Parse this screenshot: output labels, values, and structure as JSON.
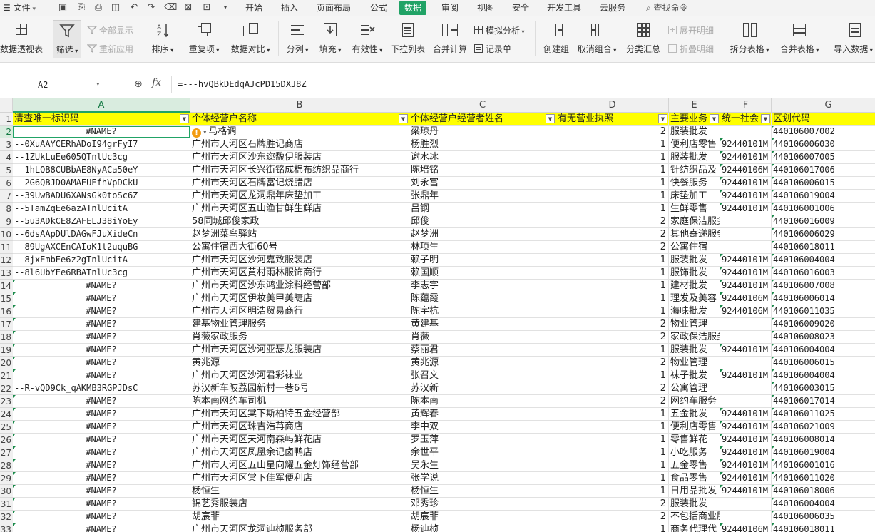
{
  "menubar": {
    "file_label": "文件",
    "tabs": [
      "开始",
      "插入",
      "页面布局",
      "公式",
      "数据",
      "审阅",
      "视图",
      "安全",
      "开发工具",
      "云服务"
    ],
    "active_tab": "数据",
    "search_label": "查找命令"
  },
  "ribbon": {
    "pivot": "数据透视表",
    "filter": "筛选",
    "show_all": "全部显示",
    "reapply": "重新应用",
    "sort": "排序",
    "duplicates": "重复项",
    "compare": "数据对比",
    "split": "分列",
    "fill": "填充",
    "validity": "有效性",
    "dropdown_list": "下拉列表",
    "merge_calc": "合并计算",
    "simulate": "模拟分析",
    "record": "记录单",
    "create_group": "创建组",
    "ungroup": "取消组合",
    "subtotal": "分类汇总",
    "expand_detail": "展开明细",
    "collapse_detail": "折叠明细",
    "split_table": "拆分表格",
    "merge_table": "合并表格",
    "import": "导入数据"
  },
  "formula_bar": {
    "cell_ref": "A2",
    "formula": "=---hvQBkDEdqAJcPD15DXJ8Z"
  },
  "columns": [
    "A",
    "B",
    "C",
    "D",
    "E",
    "F",
    "G"
  ],
  "active_column": "A",
  "header_row": [
    "清查唯一标识码",
    "个体经营户名称",
    "个体经营户经营者姓名",
    "有无营业执照",
    "主要业务",
    "统一社会",
    "区划代码"
  ],
  "rows": [
    {
      "n": "2",
      "a": "#NAME?",
      "b": "马格调",
      "c": "梁琼丹",
      "d": "2",
      "e": "服装批发",
      "f": "",
      "g": "440106007002"
    },
    {
      "n": "3",
      "a": "--0XuAAYCERhADoI94grFyI7",
      "b": "广州市天河区石牌胜记商店",
      "c": "杨胜烈",
      "d": "1",
      "e": "便利店零售",
      "f": "92440101M",
      "g": "440106006030"
    },
    {
      "n": "4",
      "a": "--1ZUkLuEe605QTnlUc3cg",
      "b": "广州市天河区沙东迩馥伊服装店",
      "c": "谢水冰",
      "d": "1",
      "e": "服装批发",
      "f": "92440101M",
      "g": "440106007005"
    },
    {
      "n": "5",
      "a": "--1hLQB8CUBbAE8NyACa50eY",
      "b": "广州市天河区长兴街铭成棉布纺织品商行",
      "c": "陈培铭",
      "d": "1",
      "e": "针纺织品及",
      "f": "92440106M",
      "g": "440106017006"
    },
    {
      "n": "6",
      "a": "--2G6QBJD0AMAEUEfhVpDCkU",
      "b": "广州市天河区石牌富记烧腊店",
      "c": "刘永富",
      "d": "1",
      "e": "快餐服务",
      "f": "92440101M",
      "g": "440106006015"
    },
    {
      "n": "7",
      "a": "--39UwBADU6XANsGk0toSc6Z",
      "b": "广州市天河区龙洞鼎年床垫加工",
      "c": "张鼎年",
      "d": "1",
      "e": "床垫加工",
      "f": "92440101M",
      "g": "440106019004"
    },
    {
      "n": "8",
      "a": "--5TamZqEe6azATnlUcitA",
      "b": "广州市天河区五山渔甘鲜生鲜店",
      "c": "吕钢",
      "d": "1",
      "e": "生鲜零售",
      "f": "92440101M",
      "g": "440106001006"
    },
    {
      "n": "9",
      "a": "--5u3ADkCE8ZAFELJ38iYoEy",
      "b": "58同城邱俊家政",
      "c": "邱俊",
      "d": "2",
      "e": "家庭保洁服务",
      "f": "",
      "g": "440106016009"
    },
    {
      "n": "10",
      "a": "--6dsAApDUlDAGwFJuXideCn",
      "b": "赵梦洲菜鸟驿站",
      "c": "赵梦洲",
      "d": "2",
      "e": "其他寄递服务",
      "f": "",
      "g": "440106006029"
    },
    {
      "n": "11",
      "a": "--89UgAXCEnCAIoK1t2uquBG",
      "b": "公寓住宿西大街60号",
      "c": "林项生",
      "d": "2",
      "e": "公寓住宿",
      "f": "",
      "g": "440106018011"
    },
    {
      "n": "12",
      "a": "--8jxEmbEe6z2gTnlUcitA",
      "b": "广州市天河区沙河嘉致服装店",
      "c": "赖子明",
      "d": "1",
      "e": "服装批发",
      "f": "92440101M",
      "g": "440106004004"
    },
    {
      "n": "13",
      "a": "--8l6UbYEe6RBATnlUc3cg",
      "b": "广州市天河区黄村雨林服饰商行",
      "c": "赖国顺",
      "d": "1",
      "e": "服饰批发",
      "f": "92440101M",
      "g": "440106016003"
    },
    {
      "n": "14",
      "a": "#NAME?",
      "b": "广州市天河区沙东鸿业涂料经营部",
      "c": "李志宇",
      "d": "1",
      "e": "建材批发",
      "f": "92440101M",
      "g": "440106007008"
    },
    {
      "n": "15",
      "a": "#NAME?",
      "b": "广州市天河区伊妆美甲美睫店",
      "c": "陈蕴霞",
      "d": "1",
      "e": "理发及美容",
      "f": "92440106M",
      "g": "440106006014"
    },
    {
      "n": "16",
      "a": "#NAME?",
      "b": "广州市天河区明浩贸易商行",
      "c": "陈宇杭",
      "d": "1",
      "e": "海味批发",
      "f": "92440106M",
      "g": "440106011035"
    },
    {
      "n": "17",
      "a": "#NAME?",
      "b": "建基物业管理服务",
      "c": "黄建基",
      "d": "2",
      "e": "物业管理",
      "f": "",
      "g": "440106009020"
    },
    {
      "n": "18",
      "a": "#NAME?",
      "b": "肖薇家政服务",
      "c": "肖薇",
      "d": "2",
      "e": "家政保洁服务",
      "f": "",
      "g": "440106008023"
    },
    {
      "n": "19",
      "a": "#NAME?",
      "b": "广州市天河区沙河亚瑟龙服装店",
      "c": "蔡丽君",
      "d": "1",
      "e": "服装批发",
      "f": "92440101M",
      "g": "440106004004"
    },
    {
      "n": "20",
      "a": "#NAME?",
      "b": "黄兆源",
      "c": "黄兆源",
      "d": "2",
      "e": "物业管理",
      "f": "",
      "g": "440106006015"
    },
    {
      "n": "21",
      "a": "#NAME?",
      "b": "广州市天河区沙河君彩袜业",
      "c": "张召文",
      "d": "1",
      "e": "袜子批发",
      "f": "92440101M",
      "g": "440106004004"
    },
    {
      "n": "22",
      "a": "--R-vQD9Ck_qAKMB3RGPJDsC",
      "b": "苏汉新车陂荔园新村一巷6号",
      "c": "苏汉新",
      "d": "2",
      "e": "公寓管理",
      "f": "",
      "g": "440106003015"
    },
    {
      "n": "23",
      "a": "#NAME?",
      "b": "陈本南网约车司机",
      "c": "陈本南",
      "d": "2",
      "e": "网约车服务",
      "f": "",
      "g": "440106017014"
    },
    {
      "n": "24",
      "a": "#NAME?",
      "b": "广州市天河区棠下斯柏特五金经营部",
      "c": "黄辉春",
      "d": "1",
      "e": "五金批发",
      "f": "92440101M",
      "g": "440106011025"
    },
    {
      "n": "25",
      "a": "#NAME?",
      "b": "广州市天河区珠吉浩苒商店",
      "c": "李中双",
      "d": "1",
      "e": "便利店零售",
      "f": "92440101M",
      "g": "440106021009"
    },
    {
      "n": "26",
      "a": "#NAME?",
      "b": "广州市天河区天河南森屿鲜花店",
      "c": "罗玉萍",
      "d": "1",
      "e": "零售鲜花",
      "f": "92440101M",
      "g": "440106008014"
    },
    {
      "n": "27",
      "a": "#NAME?",
      "b": "广州市天河区凤凰余记卤鸭店",
      "c": "余世平",
      "d": "1",
      "e": "小吃服务",
      "f": "92440101M",
      "g": "440106019004"
    },
    {
      "n": "28",
      "a": "#NAME?",
      "b": "广州市天河区五山星向耀五金灯饰经营部",
      "c": "吴永生",
      "d": "1",
      "e": "五金零售",
      "f": "92440101M",
      "g": "440106001016"
    },
    {
      "n": "29",
      "a": "#NAME?",
      "b": "广州市天河区棠下佳军便利店",
      "c": "张学说",
      "d": "1",
      "e": "食品零售",
      "f": "92440101M",
      "g": "440106011020"
    },
    {
      "n": "30",
      "a": "#NAME?",
      "b": "杨恒生",
      "c": "杨恒生",
      "d": "1",
      "e": "日用品批发",
      "f": "92440101M",
      "g": "440106018006"
    },
    {
      "n": "31",
      "a": "#NAME?",
      "b": "锦艺秀服装店",
      "c": "邓秀珍",
      "d": "2",
      "e": "服装批发",
      "f": "",
      "g": "440106004004"
    },
    {
      "n": "32",
      "a": "#NAME?",
      "b": "胡宸菲",
      "c": "胡宸菲",
      "d": "2",
      "e": "不包括商业服务",
      "f": "",
      "g": "440106006035"
    },
    {
      "n": "33",
      "a": "#NAME?",
      "b": "广州市天河区龙洞迪桢服务部",
      "c": "杨迪桢",
      "d": "1",
      "e": "商务代理代",
      "f": "92440106M",
      "g": "440106018011"
    }
  ]
}
